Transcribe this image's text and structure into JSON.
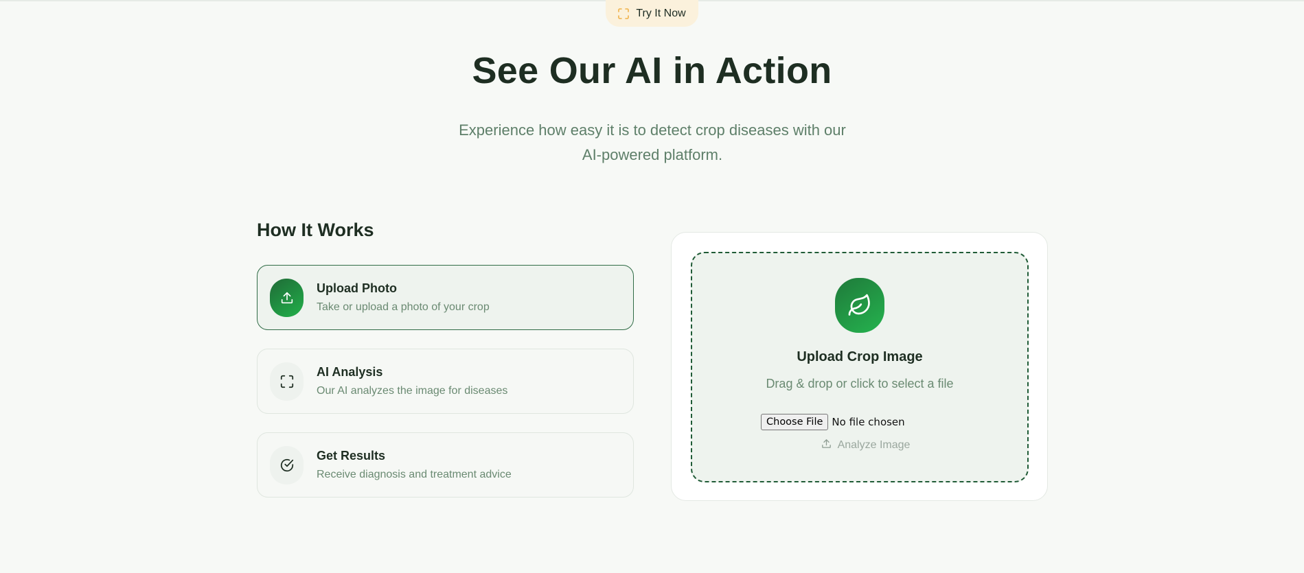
{
  "badge": {
    "label": "Try It Now",
    "icon": "scan-icon"
  },
  "hero": {
    "title": "See Our AI in Action",
    "subtitle_line1": "Experience how easy it is to detect crop diseases with our",
    "subtitle_line2": "AI-powered platform."
  },
  "how_it_works": {
    "title": "How It Works",
    "steps": [
      {
        "title": "Upload Photo",
        "desc": "Take or upload a photo of your crop",
        "icon": "upload-icon",
        "active": true
      },
      {
        "title": "AI Analysis",
        "desc": "Our AI analyzes the image for diseases",
        "icon": "scan-icon",
        "active": false
      },
      {
        "title": "Get Results",
        "desc": "Receive diagnosis and treatment advice",
        "icon": "check-circle-icon",
        "active": false
      }
    ]
  },
  "upload": {
    "icon": "leaf-icon",
    "title": "Upload Crop Image",
    "desc": "Drag & drop or click to select a file",
    "choose_label": "Choose File",
    "file_status": "No file chosen",
    "analyze_label": "Analyze Image"
  },
  "colors": {
    "accent_green": "#22b04a",
    "dark_green": "#1f5b36",
    "badge_bg": "#fbf1dc",
    "muted_text": "#6a8a72"
  }
}
